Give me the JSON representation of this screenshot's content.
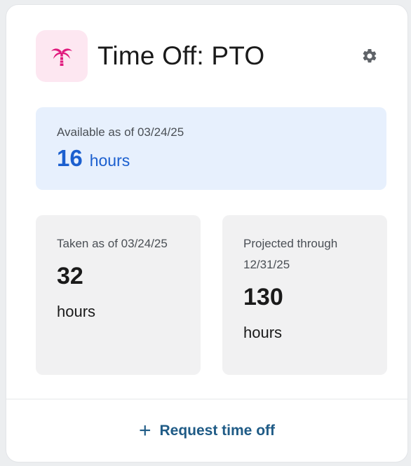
{
  "card": {
    "title": "Time Off: PTO",
    "header_icon": "palm-tree-icon",
    "settings_icon": "gear-icon"
  },
  "available": {
    "label": "Available as of 03/24/25",
    "value": "16",
    "unit": "hours"
  },
  "taken": {
    "label": "Taken as of 03/24/25",
    "value": "32",
    "unit": "hours"
  },
  "projected": {
    "label": "Projected through 12/31/25",
    "value": "130",
    "unit": "hours"
  },
  "footer": {
    "action_icon": "plus-icon",
    "plus_glyph": "+",
    "action_label": "Request time off"
  },
  "colors": {
    "accent_pink": "#e0197d",
    "available_bg": "#e7f0fd",
    "available_text": "#1b5fcf",
    "action_text": "#1f5b86"
  }
}
